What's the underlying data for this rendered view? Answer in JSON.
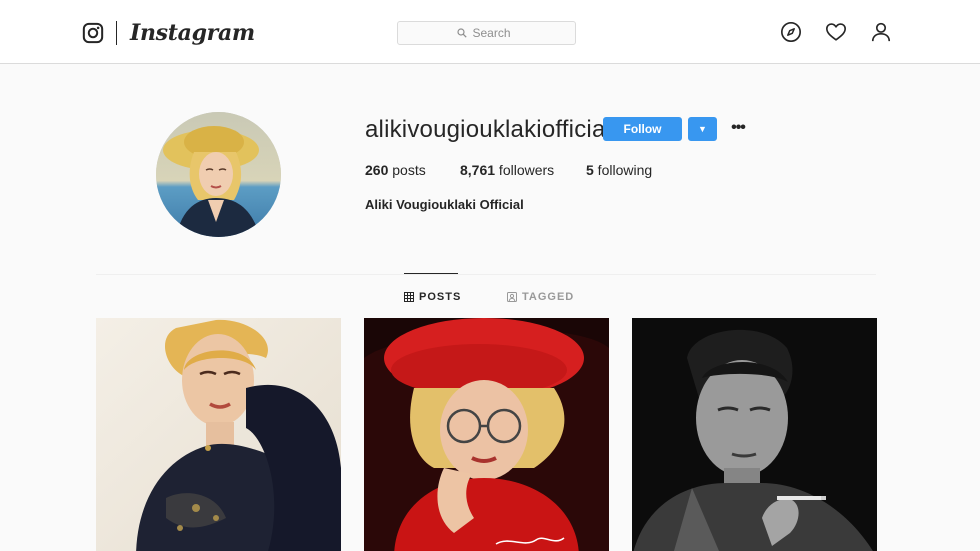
{
  "header": {
    "brand": "Instagram",
    "logo_icon": "instagram-camera-icon",
    "search": {
      "placeholder": "Search",
      "icon": "search-icon"
    },
    "nav_icons": [
      "compass-icon",
      "heart-icon",
      "user-icon"
    ]
  },
  "profile": {
    "username": "alikivougiouklakiofficial",
    "follow_label": "Follow",
    "dropdown_icon": "caret-down-icon",
    "more_icon": "ellipsis-icon",
    "stats": {
      "posts_count": "260",
      "posts_label": " posts",
      "followers_count": "8,761",
      "followers_label": " followers",
      "following_count": "5",
      "following_label": " following"
    },
    "full_name": "Aliki Vougiouklaki Official"
  },
  "tabs": [
    {
      "label": "POSTS",
      "icon": "grid-icon",
      "active": true
    },
    {
      "label": "TAGGED",
      "icon": "tag-person-icon",
      "active": false
    }
  ],
  "posts": [
    {
      "description_icon": "photo-woman-blonde-fur"
    },
    {
      "description_icon": "photo-woman-red-beret",
      "caption_overlay": ""
    },
    {
      "description_icon": "photo-man-black-white"
    }
  ],
  "colors": {
    "accent": "#3897f0",
    "text": "#262626",
    "muted": "#8e8e8e",
    "border": "#dbdbdb",
    "background": "#fafafa"
  }
}
